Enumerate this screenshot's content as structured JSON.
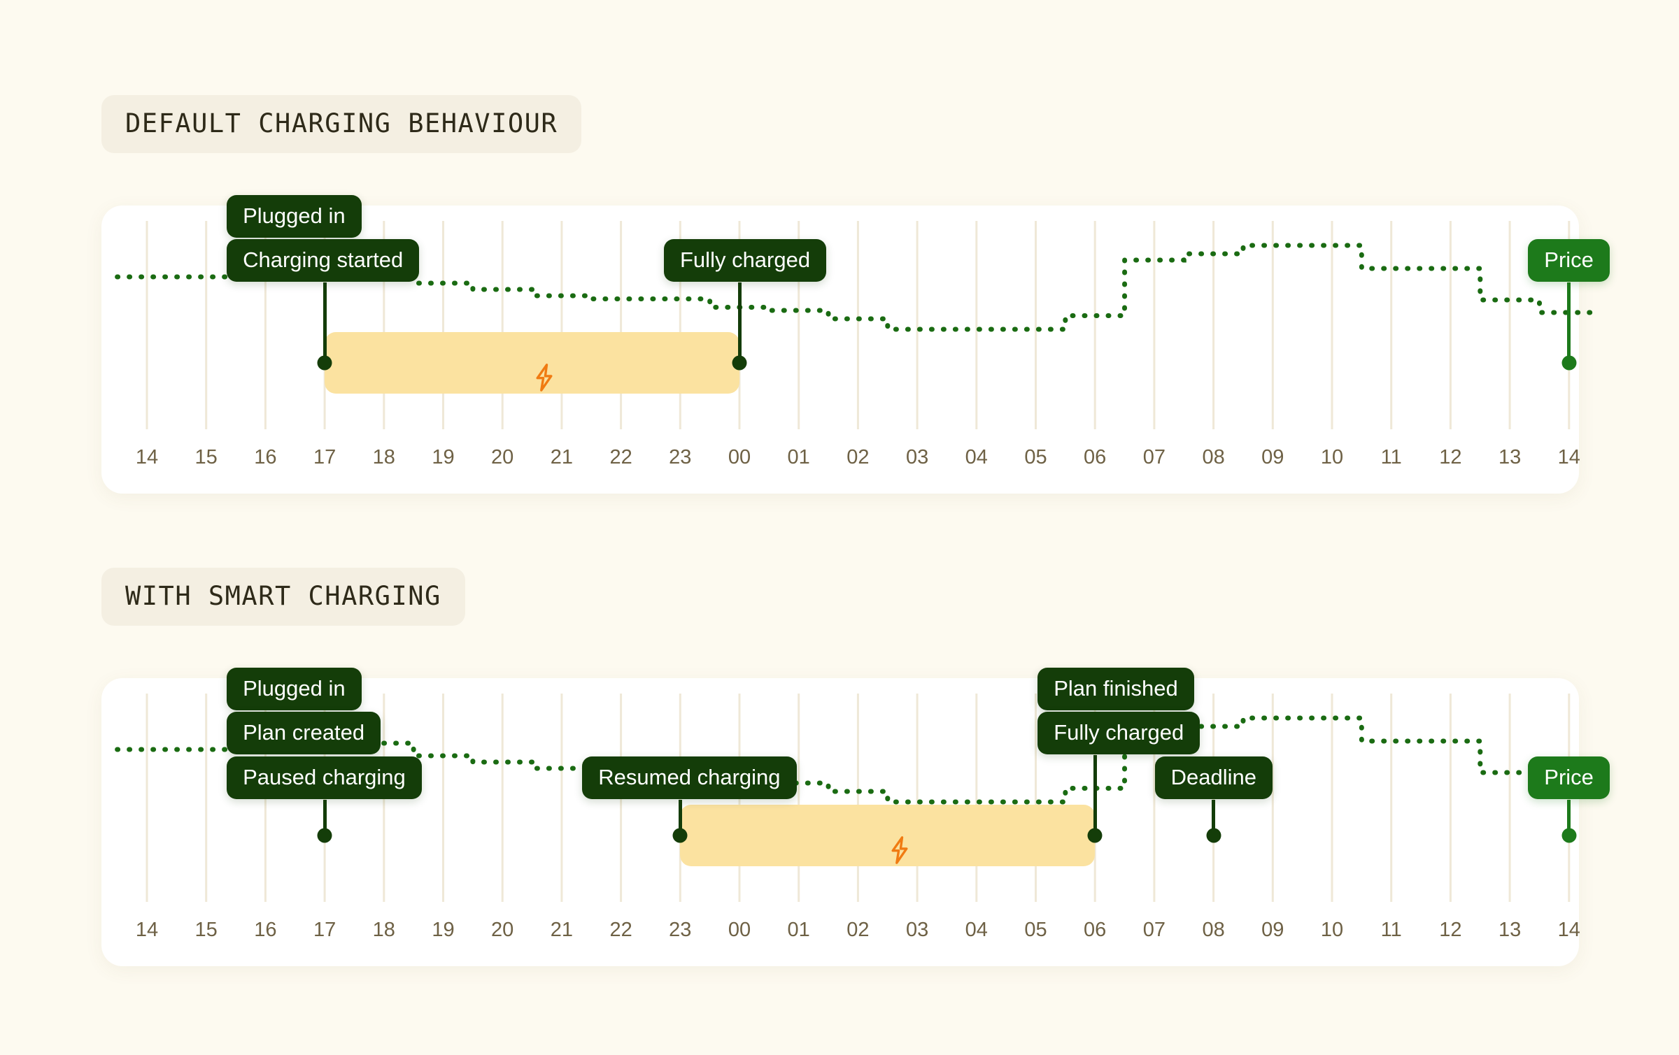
{
  "page": {
    "background_color": "#fdfaf0",
    "card_color": "#ffffff",
    "title_badge_color": "#f4efe2",
    "accent_dark_green": "#143d09",
    "accent_price_green": "#1d7a1b",
    "band_color": "#fbe2a0",
    "bolt_color": "#f07b12",
    "gridline_color": "#efe8d7",
    "tick_color": "#6e6145"
  },
  "sections": [
    {
      "id": "default",
      "title": "DEFAULT CHARGING BEHAVIOUR",
      "axis_ticks": [
        "14",
        "15",
        "16",
        "17",
        "18",
        "19",
        "20",
        "21",
        "22",
        "23",
        "00",
        "01",
        "02",
        "03",
        "04",
        "05",
        "06",
        "07",
        "08",
        "09",
        "10",
        "11",
        "12",
        "13",
        "14"
      ],
      "events": [
        {
          "name": "plugged-in",
          "label": "Plugged in",
          "hour": 17,
          "has_stem": false,
          "has_dot": false,
          "row": 0
        },
        {
          "name": "charging-started",
          "label": "Charging started",
          "hour": 17,
          "has_stem": true,
          "has_dot": true,
          "row": 1
        },
        {
          "name": "fully-charged",
          "label": "Fully charged",
          "hour": 24,
          "has_stem": true,
          "has_dot": true,
          "row": 1
        },
        {
          "name": "price",
          "label": "Price",
          "hour": 38,
          "has_stem": true,
          "has_dot": true,
          "row": 1,
          "variant": "price"
        }
      ],
      "charging_band": {
        "start_hour": 17,
        "end_hour": 24,
        "icon": "lightning-bolt-icon"
      }
    },
    {
      "id": "smart",
      "title": "WITH SMART CHARGING",
      "axis_ticks": [
        "14",
        "15",
        "16",
        "17",
        "18",
        "19",
        "20",
        "21",
        "22",
        "23",
        "00",
        "01",
        "02",
        "03",
        "04",
        "05",
        "06",
        "07",
        "08",
        "09",
        "10",
        "11",
        "12",
        "13",
        "14"
      ],
      "events": [
        {
          "name": "plugged-in",
          "label": "Plugged in",
          "hour": 17,
          "has_stem": false,
          "has_dot": false,
          "row": 0
        },
        {
          "name": "plan-created",
          "label": "Plan created",
          "hour": 17,
          "has_stem": false,
          "has_dot": false,
          "row": 1
        },
        {
          "name": "paused-charging",
          "label": "Paused charging",
          "hour": 17,
          "has_stem": true,
          "has_dot": true,
          "row": 2
        },
        {
          "name": "resumed-charging",
          "label": "Resumed charging",
          "hour": 23,
          "has_stem": true,
          "has_dot": true,
          "row": 2
        },
        {
          "name": "plan-finished",
          "label": "Plan finished",
          "hour": 30,
          "has_stem": false,
          "has_dot": false,
          "row": 0
        },
        {
          "name": "fully-charged",
          "label": "Fully charged",
          "hour": 30,
          "has_stem": true,
          "has_dot": true,
          "row": 1
        },
        {
          "name": "deadline",
          "label": "Deadline",
          "hour": 32,
          "has_stem": true,
          "has_dot": true,
          "row": 2
        },
        {
          "name": "price",
          "label": "Price",
          "hour": 38,
          "has_stem": true,
          "has_dot": true,
          "row": 2,
          "variant": "price"
        }
      ],
      "charging_band": {
        "start_hour": 23,
        "end_hour": 30,
        "icon": "lightning-bolt-icon"
      }
    }
  ],
  "chart_data": [
    {
      "type": "line",
      "subtype": "step",
      "title": "DEFAULT CHARGING BEHAVIOUR",
      "xlabel": "",
      "ylabel": "Price",
      "legend": [
        "Price"
      ],
      "legend_position": "inline-right-end",
      "grid": true,
      "grid_axis": "x",
      "x": [
        "14",
        "15",
        "16",
        "17",
        "18",
        "19",
        "20",
        "21",
        "22",
        "23",
        "00",
        "01",
        "02",
        "03",
        "04",
        "05",
        "06",
        "07",
        "08",
        "09",
        "10",
        "11",
        "12",
        "13",
        "14"
      ],
      "ylim": [
        0,
        100
      ],
      "series": [
        {
          "name": "Price",
          "style": "dotted-step",
          "color": "#1a6b12",
          "values": [
            62,
            62,
            74,
            74,
            68,
            56,
            50,
            44,
            41,
            41,
            33,
            30,
            22,
            12,
            12,
            12,
            25,
            78,
            84,
            92,
            92,
            70,
            70,
            40,
            28,
            22,
            20
          ]
        }
      ],
      "annotations": [
        {
          "label": "Plugged in",
          "x": "17"
        },
        {
          "label": "Charging started",
          "x": "17"
        },
        {
          "label": "Fully charged",
          "x": "00"
        },
        {
          "label": "Price",
          "x": "14"
        }
      ],
      "shaded_region": {
        "label": "charging",
        "from": "17",
        "to": "00",
        "color": "#fbe2a0"
      }
    },
    {
      "type": "line",
      "subtype": "step",
      "title": "WITH SMART CHARGING",
      "xlabel": "",
      "ylabel": "Price",
      "legend": [
        "Price"
      ],
      "legend_position": "inline-right-end",
      "grid": true,
      "grid_axis": "x",
      "x": [
        "14",
        "15",
        "16",
        "17",
        "18",
        "19",
        "20",
        "21",
        "22",
        "23",
        "00",
        "01",
        "02",
        "03",
        "04",
        "05",
        "06",
        "07",
        "08",
        "09",
        "10",
        "11",
        "12",
        "13",
        "14"
      ],
      "ylim": [
        0,
        100
      ],
      "series": [
        {
          "name": "Price",
          "style": "dotted-step",
          "color": "#1a6b12",
          "values": [
            62,
            62,
            74,
            74,
            68,
            56,
            50,
            44,
            41,
            41,
            33,
            30,
            22,
            12,
            12,
            12,
            25,
            78,
            84,
            92,
            92,
            70,
            70,
            40,
            28,
            22,
            20
          ]
        }
      ],
      "annotations": [
        {
          "label": "Plugged in",
          "x": "17"
        },
        {
          "label": "Plan created",
          "x": "17"
        },
        {
          "label": "Paused charging",
          "x": "17"
        },
        {
          "label": "Resumed charging",
          "x": "23"
        },
        {
          "label": "Plan finished",
          "x": "06"
        },
        {
          "label": "Fully charged",
          "x": "06"
        },
        {
          "label": "Deadline",
          "x": "08"
        },
        {
          "label": "Price",
          "x": "14"
        }
      ],
      "shaded_region": {
        "label": "charging",
        "from": "23",
        "to": "06",
        "color": "#fbe2a0"
      }
    }
  ]
}
